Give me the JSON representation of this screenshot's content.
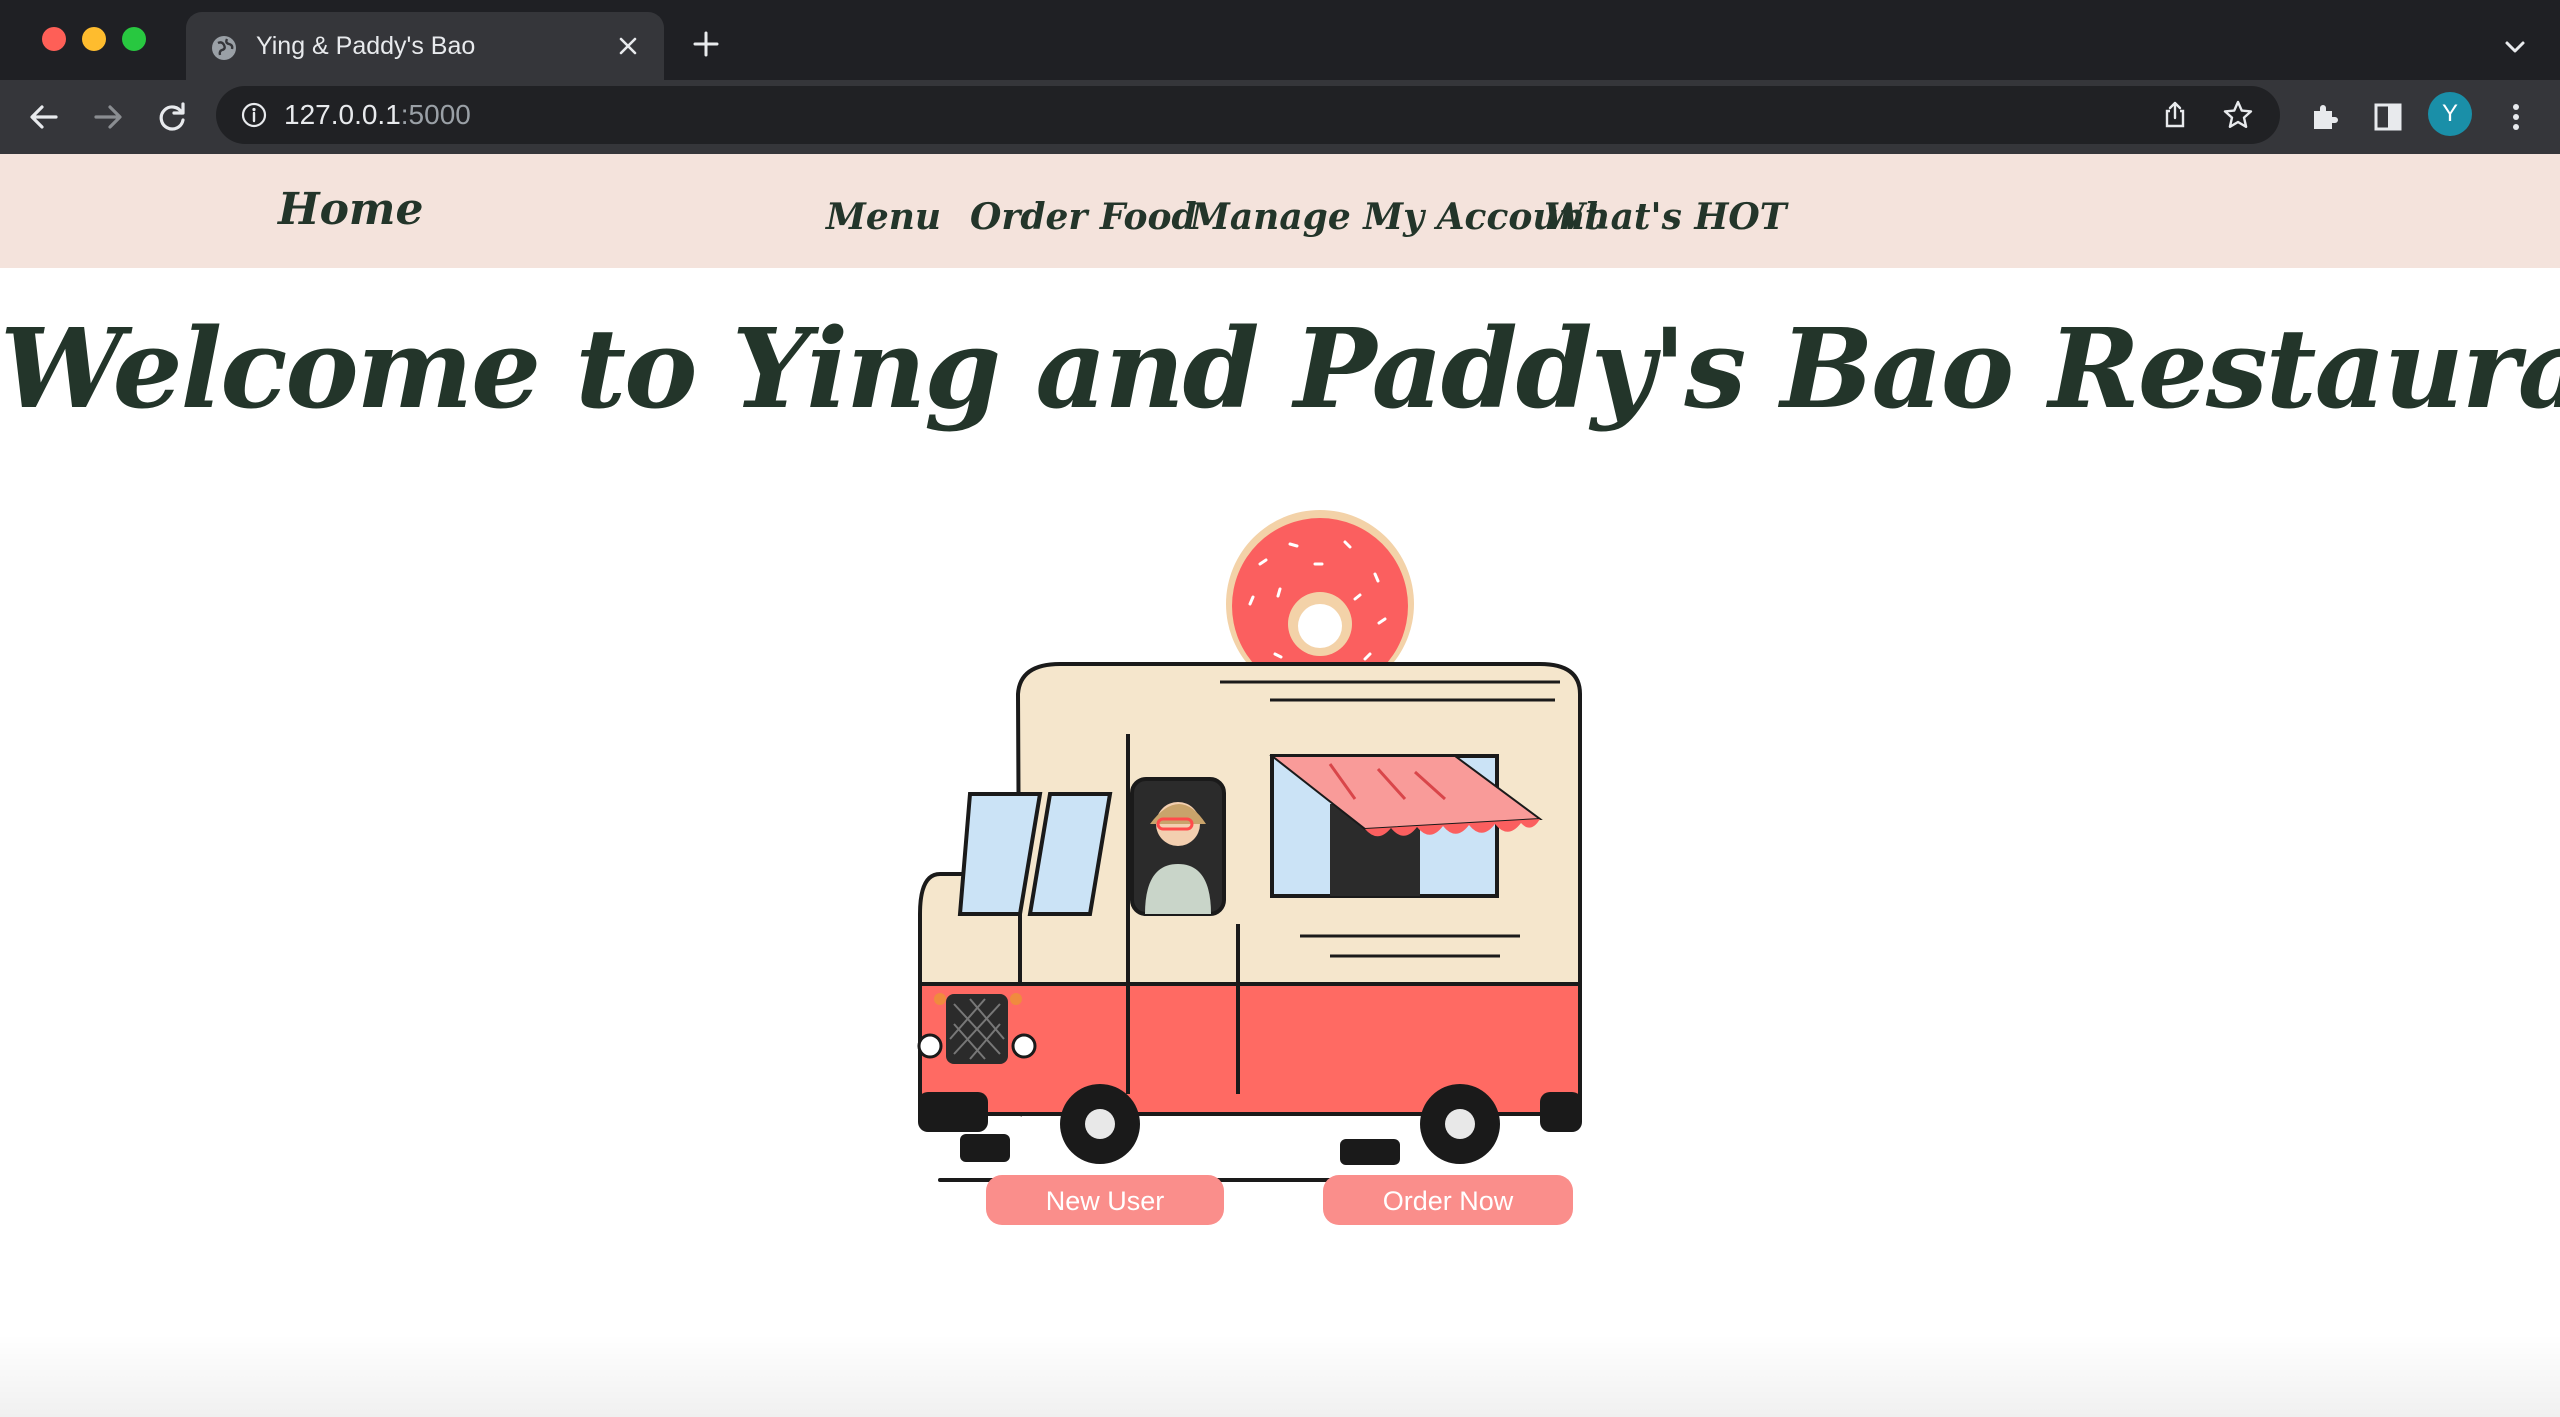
{
  "browser": {
    "tab_title": "Ying & Paddy's Bao",
    "url_host": "127.0.0.1",
    "url_port": ":5000",
    "profile_initial": "Y"
  },
  "nav": {
    "home": "Home",
    "links": [
      "Menu",
      "Order Food",
      "Manage My Account",
      "What's HOT"
    ]
  },
  "main": {
    "headline": "Welcome to Ying and Paddy's Bao Restaurant",
    "buttons": {
      "new_user": "New User",
      "order_now": "Order Now"
    }
  },
  "colors": {
    "navbar_bg": "#f4e3dc",
    "heading_text": "#23352a",
    "button_bg": "#fa8e8b",
    "truck_red": "#ff6a63",
    "truck_cream": "#f5e6cc",
    "donut_icing": "#fb5f5f"
  },
  "icons": [
    "globe-icon",
    "close-icon",
    "plus-icon",
    "chevron-down-icon",
    "back-arrow-icon",
    "forward-arrow-icon",
    "reload-icon",
    "info-icon",
    "share-icon",
    "star-icon",
    "puzzle-icon",
    "sidebar-icon",
    "more-vert-icon"
  ]
}
